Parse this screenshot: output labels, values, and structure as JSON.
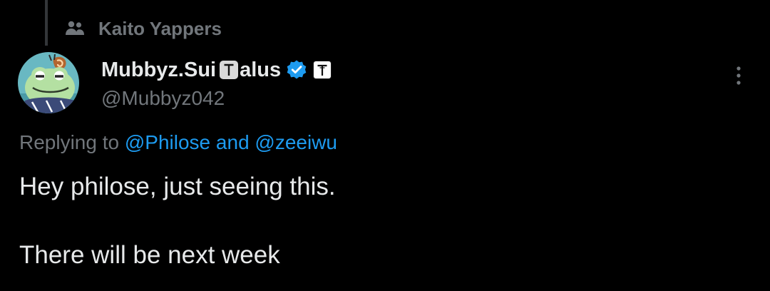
{
  "community": {
    "icon": "people-icon",
    "label": "Kaito Yappers"
  },
  "author": {
    "avatar": "frog-avatar",
    "display_name": "Mubbyz.Sui",
    "name_glyph_letter": "T",
    "display_name_suffix": "alus",
    "verified_icon": "verified-badge-icon",
    "affiliate_badge_letter": "T",
    "handle": "@Mubbyz042"
  },
  "more_menu_icon": "more-vertical-icon",
  "reply_context": {
    "prefix": "Replying to",
    "mention_1": "@Philose",
    "connector": "and",
    "mention_2": "@zeeiwu"
  },
  "post": {
    "line_1": "Hey philose, just seeing this.",
    "line_2": "There will be next week"
  },
  "colors": {
    "background": "#000000",
    "primary_text": "#e7e9ea",
    "secondary_text": "#71767b",
    "link": "#1d9bf0",
    "verified": "#1d9bf0"
  }
}
